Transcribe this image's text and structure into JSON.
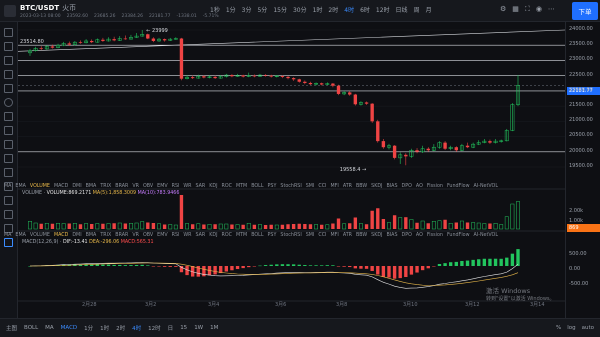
{
  "header": {
    "symbol": "BTC/USDT",
    "exchange": "火币",
    "ohlc": [
      "2023-03-13 08:00",
      "23592.60",
      "23685.26",
      "23384.26",
      "22181.77",
      "-1338.01",
      "-5.71%"
    ],
    "timeframes": [
      {
        "label": "1秒",
        "state": ""
      },
      {
        "label": "1分",
        "state": ""
      },
      {
        "label": "3分",
        "state": ""
      },
      {
        "label": "5分",
        "state": ""
      },
      {
        "label": "15分",
        "state": ""
      },
      {
        "label": "30分",
        "state": ""
      },
      {
        "label": "1时",
        "state": ""
      },
      {
        "label": "2时",
        "state": ""
      },
      {
        "label": "4时",
        "state": "active"
      },
      {
        "label": "6时",
        "state": ""
      },
      {
        "label": "12时",
        "state": ""
      },
      {
        "label": "日线",
        "state": ""
      },
      {
        "label": "周",
        "state": ""
      },
      {
        "label": "月",
        "state": ""
      }
    ],
    "trade_button": "下单"
  },
  "indicator_row_main": {
    "items": [
      "MA",
      "EMA",
      "VOLUME",
      "MACD",
      "DMI",
      "BMA",
      "TRIX",
      "BRAR",
      "VR",
      "OBV",
      "EMV",
      "RSI",
      "WR",
      "SAR",
      "KDJ",
      "ROC",
      "MTM",
      "BOLL",
      "PSY",
      "StochRSI",
      "SMI",
      "CCI",
      "MFI",
      "ATR",
      "BBW",
      "SKDJ",
      "BIAS",
      "DPO",
      "AO",
      "Fission",
      "FundFlow",
      "AI-NetVOL"
    ],
    "active": [
      "VOLUME"
    ]
  },
  "indicator_row_macd": {
    "items": [
      "MA",
      "EMA",
      "VOLUME",
      "MACD",
      "DMI",
      "BMA",
      "TRIX",
      "BRAR",
      "VR",
      "OBV",
      "EMV",
      "RSI",
      "WR",
      "SAR",
      "KDJ",
      "ROC",
      "MTM",
      "BOLL",
      "PSY",
      "StochRSI",
      "SMI",
      "CCI",
      "MFI",
      "ATR",
      "BBW",
      "SKDJ",
      "BIAS",
      "DPO",
      "AO",
      "Fission",
      "FundFlow",
      "AI-NetVOL"
    ],
    "active": [
      "MACD"
    ]
  },
  "volume_panel": {
    "title": "VOLUME",
    "value": "VOLUME:869.2171",
    "ma5": "MA(5):1,858.3009",
    "ma10": "MA(10):783.9466",
    "axis_labels": [
      "2.00k",
      "1.00k"
    ],
    "current_tag": "869"
  },
  "macd_panel": {
    "title": "MACD(12,26,9)",
    "dif": "DIF:-13.41",
    "dea": "DEA:-296.06",
    "macd": "MACD:565.31",
    "axis_labels": [
      "500.00",
      "0.00",
      "-500.00"
    ]
  },
  "price_axis": {
    "labels": [
      "24000.00",
      "23500.00",
      "23000.00",
      "22500.00",
      "22000.00",
      "21500.00",
      "21000.00",
      "20500.00",
      "20000.00",
      "19500.00"
    ],
    "current_price": "22181.77"
  },
  "chart_annotations": {
    "high_label": "23999",
    "low_label": "19558.4",
    "left_label": "23514.80"
  },
  "x_axis_dates": [
    "2月28",
    "3月2",
    "3月4",
    "3月6",
    "3月8",
    "3月10",
    "3月12",
    "3月14"
  ],
  "bottom_bar": {
    "items": [
      {
        "label": "主图",
        "on": false
      },
      {
        "label": "BOLL",
        "on": false
      },
      {
        "label": "MA",
        "on": false
      },
      {
        "label": "MACD",
        "on": true
      },
      {
        "label": "1分",
        "on": false
      },
      {
        "label": "1时",
        "on": false
      },
      {
        "label": "2时",
        "on": false
      },
      {
        "label": "4时",
        "on": true
      },
      {
        "label": "12时",
        "on": false
      },
      {
        "label": "日",
        "on": false
      },
      {
        "label": "15",
        "on": false
      },
      {
        "label": "1W",
        "on": false
      },
      {
        "label": "1M",
        "on": false
      }
    ],
    "right": [
      "%",
      "log",
      "auto"
    ]
  },
  "watermark": {
    "title": "激活 Windows",
    "subtitle": "转到\"设置\"以激活 Windows。"
  },
  "colors": {
    "up": "#22c55e",
    "down": "#ef4444",
    "accent": "#1f6fff",
    "ma5": "#e8b84a",
    "ma10": "#c77dff"
  }
}
